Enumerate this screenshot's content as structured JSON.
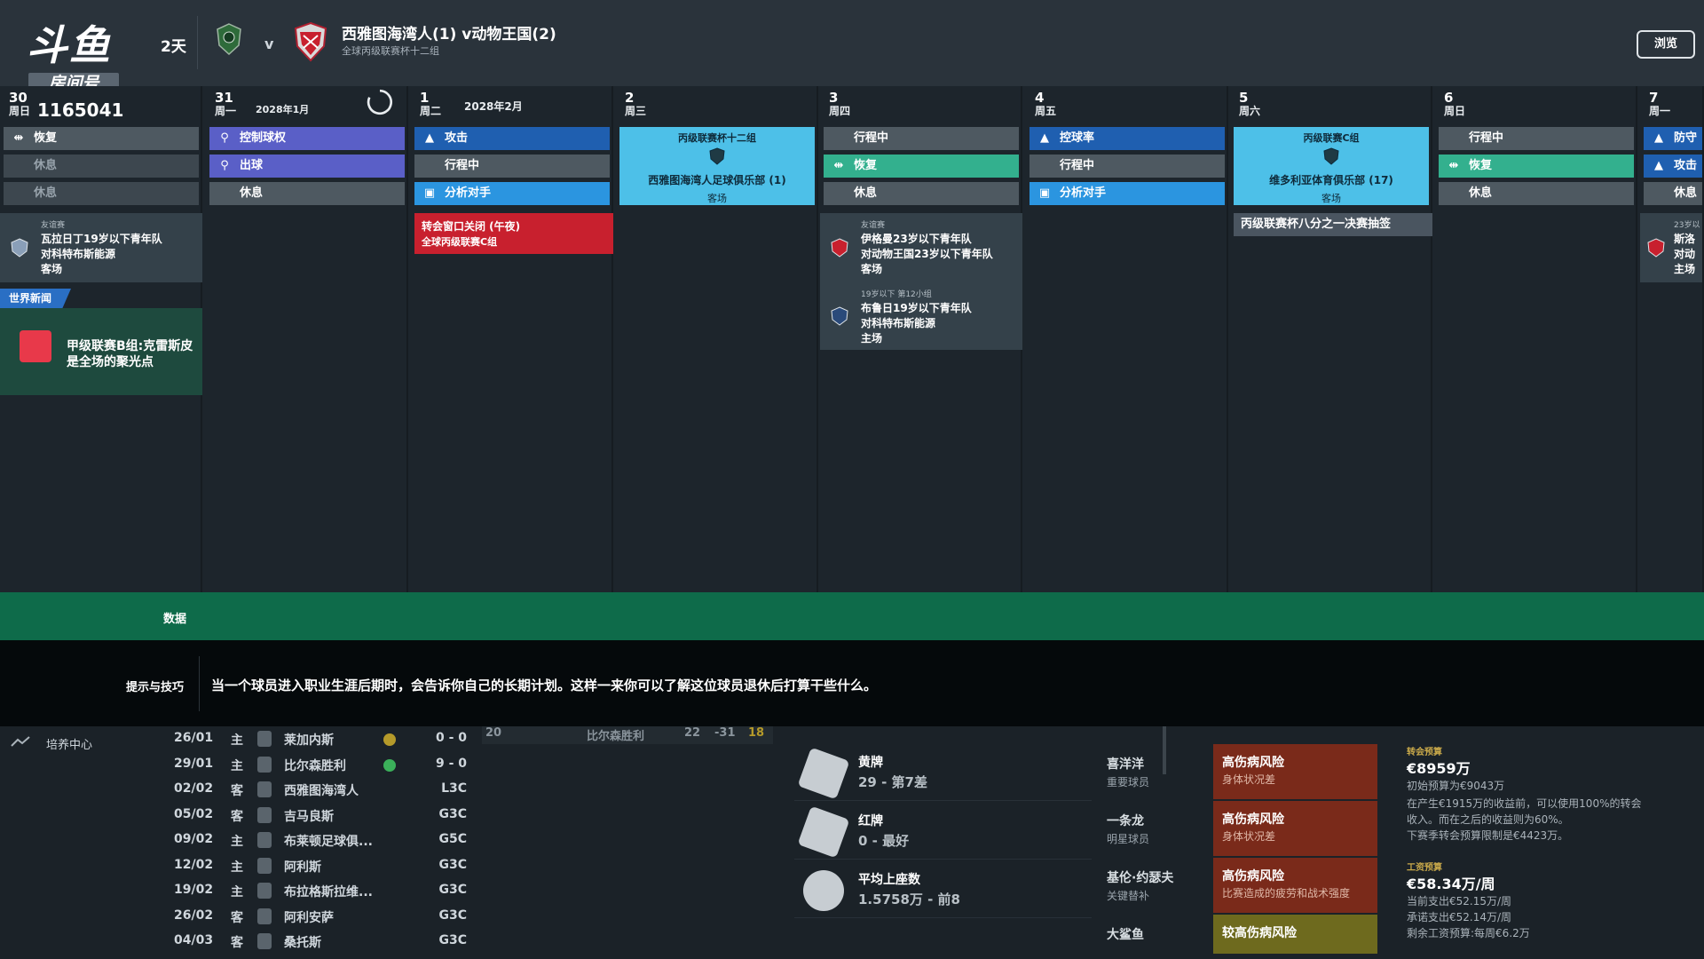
{
  "header": {
    "logo_big": "斗鱼",
    "logo_small": "房间号",
    "days_left": "2天",
    "vs": "v",
    "match_title": "西雅图海湾人(1) v动物王国(2)",
    "match_subtitle": "全球丙级联赛杯十二组",
    "browse_label": "浏览",
    "room_number": "1165041"
  },
  "calendar": {
    "columns": [
      {
        "num": "30",
        "day": "周日",
        "month": "",
        "chips": [
          {
            "label": "恢复",
            "icon": "recovery-icon",
            "style": "grey"
          },
          {
            "label": "休息",
            "icon": "",
            "style": "grey-dim"
          },
          {
            "label": "休息",
            "icon": "",
            "style": "grey-dim"
          }
        ]
      },
      {
        "num": "31",
        "day": "周一",
        "month": "2028年1月",
        "chips": [
          {
            "label": "控制球权",
            "icon": "possession-icon",
            "style": "purple"
          },
          {
            "label": "出球",
            "icon": "possession-icon",
            "style": "purple"
          },
          {
            "label": "休息",
            "icon": "",
            "style": "grey"
          }
        ]
      },
      {
        "num": "1",
        "day": "周二",
        "month": "2028年2月",
        "chips": [
          {
            "label": "攻击",
            "icon": "attack-icon",
            "style": "blue"
          },
          {
            "label": "行程中",
            "icon": "",
            "style": "grey"
          },
          {
            "label": "分析对手",
            "icon": "analysis-icon",
            "style": "sky"
          }
        ]
      },
      {
        "num": "2",
        "day": "周三",
        "month": "",
        "chips": []
      },
      {
        "num": "3",
        "day": "周四",
        "month": "",
        "chips": [
          {
            "label": "行程中",
            "icon": "",
            "style": "grey"
          },
          {
            "label": "恢复",
            "icon": "recovery-icon",
            "style": "teal"
          },
          {
            "label": "休息",
            "icon": "",
            "style": "grey"
          }
        ]
      },
      {
        "num": "4",
        "day": "周五",
        "month": "",
        "chips": [
          {
            "label": "控球率",
            "icon": "attack-icon",
            "style": "blue"
          },
          {
            "label": "行程中",
            "icon": "",
            "style": "grey"
          },
          {
            "label": "分析对手",
            "icon": "analysis-icon",
            "style": "sky"
          }
        ]
      },
      {
        "num": "5",
        "day": "周六",
        "month": "",
        "chips": []
      },
      {
        "num": "6",
        "day": "周日",
        "month": "",
        "chips": [
          {
            "label": "行程中",
            "icon": "",
            "style": "grey"
          },
          {
            "label": "恢复",
            "icon": "recovery-icon",
            "style": "teal"
          },
          {
            "label": "休息",
            "icon": "",
            "style": "grey"
          }
        ]
      },
      {
        "num": "7",
        "day": "周一",
        "month": "",
        "chips": [
          {
            "label": "防守",
            "icon": "attack-icon",
            "style": "blue"
          },
          {
            "label": "攻击",
            "icon": "attack-icon",
            "style": "blue"
          },
          {
            "label": "休息",
            "icon": "",
            "style": "grey"
          }
        ]
      }
    ],
    "match_feb2": {
      "competition": "丙级联赛杯十二组",
      "team": "西雅图海湾人足球俱乐部 (1)",
      "venue": "客场"
    },
    "match_feb5": {
      "competition": "丙级联赛C组",
      "team": "维多利亚体育俱乐部 (17)",
      "venue": "客场"
    },
    "evt_jan30": {
      "tag": "友谊赛",
      "line1": "瓦拉日丁19岁以下青年队",
      "line2": "对科特布斯能源",
      "line3": "客场"
    },
    "world_news_tag": "世界新闻",
    "world_news_text": "甲级联赛B组:克雷斯皮是全场的聚光点",
    "evt_feb1": {
      "line1": "转会窗口关闭 (午夜)",
      "line2": "全球丙级联赛C组"
    },
    "evt_feb3a": {
      "tag": "友谊赛",
      "line1": "伊格曼23岁以下青年队",
      "line2": "对动物王国23岁以下青年队",
      "line3": "客场"
    },
    "evt_feb3b": {
      "tag": "19岁以下 第12小组",
      "line1": "布鲁日19岁以下青年队",
      "line2": "对科特布斯能源",
      "line3": "主场"
    },
    "evt_feb5": "丙级联赛杯八分之一决赛抽签",
    "evt_feb7": {
      "tag": "23岁以",
      "line1": "斯洛",
      "line2": "对动",
      "line3": "主场"
    }
  },
  "data_bar_label": "数据",
  "tips": {
    "label": "提示与技巧",
    "text": "当一个球员进入职业生涯后期时，会告诉你自己的长期计划。这样一来你可以了解这位球员退休后打算干些什么。"
  },
  "bottom": {
    "nav_label": "培养中心",
    "partial_row": {
      "num": "20",
      "team": "比尔森胜利",
      "a": "22",
      "b": "-31",
      "c": "18"
    },
    "fixtures": [
      {
        "date": "26/01",
        "ha": "主",
        "team": "莱加内斯",
        "result": "0 - 0"
      },
      {
        "date": "29/01",
        "ha": "主",
        "team": "比尔森胜利",
        "result": "9 - 0"
      },
      {
        "date": "02/02",
        "ha": "客",
        "team": "西雅图海湾人",
        "result": "L3C"
      },
      {
        "date": "05/02",
        "ha": "客",
        "team": "吉马良斯",
        "result": "G3C"
      },
      {
        "date": "09/02",
        "ha": "主",
        "team": "布莱顿足球俱...",
        "result": "G5C"
      },
      {
        "date": "12/02",
        "ha": "主",
        "team": "阿利斯",
        "result": "G3C"
      },
      {
        "date": "19/02",
        "ha": "主",
        "team": "布拉格斯拉维...",
        "result": "G3C"
      },
      {
        "date": "26/02",
        "ha": "客",
        "team": "阿利安萨",
        "result": "G3C"
      },
      {
        "date": "04/03",
        "ha": "客",
        "team": "桑托斯",
        "result": "G3C"
      }
    ],
    "stats": [
      {
        "name": "黄牌",
        "value": "29 - 第7差"
      },
      {
        "name": "红牌",
        "value": "0 - 最好"
      },
      {
        "name": "平均上座数",
        "value": "1.5758万 - 前8"
      }
    ],
    "injuries": [
      {
        "player": "喜洋洋",
        "role": "重要球员",
        "risk": "高伤病风险",
        "reason": "身体状况差"
      },
      {
        "player": "一条龙",
        "role": "明星球员",
        "risk": "高伤病风险",
        "reason": "身体状况差"
      },
      {
        "player": "基伦·约瑟夫",
        "role": "关键替补",
        "risk": "高伤病风险",
        "reason": "比赛造成的疲劳和战术强度"
      },
      {
        "player": "大鲨鱼",
        "role": "",
        "risk": "较高伤病风险",
        "reason": ""
      }
    ],
    "budget": {
      "transfer_label": "转会预算",
      "transfer_value": "€8959万",
      "transfer_l1": "初始预算为€9043万",
      "transfer_l2": "在产生€1915万的收益前，可以使用100%的转会",
      "transfer_l3": "收入。而在之后的收益则为60%。",
      "transfer_l4": "下赛季转会预算限制是€4423万。",
      "wage_label": "工资预算",
      "wage_value": "€58.34万/周",
      "wage_l1": "当前支出€52.15万/周",
      "wage_l2": "承诺支出€52.14万/周",
      "wage_l3": "剩余工资预算:每周€6.2万"
    }
  },
  "colors": {
    "green_bar": "#0e6b4a",
    "red_event": "#c8202e",
    "match_cyan": "#4dc0e8",
    "purple": "#5a5fc7",
    "blue": "#1f5fb0",
    "teal": "#33b08e"
  }
}
